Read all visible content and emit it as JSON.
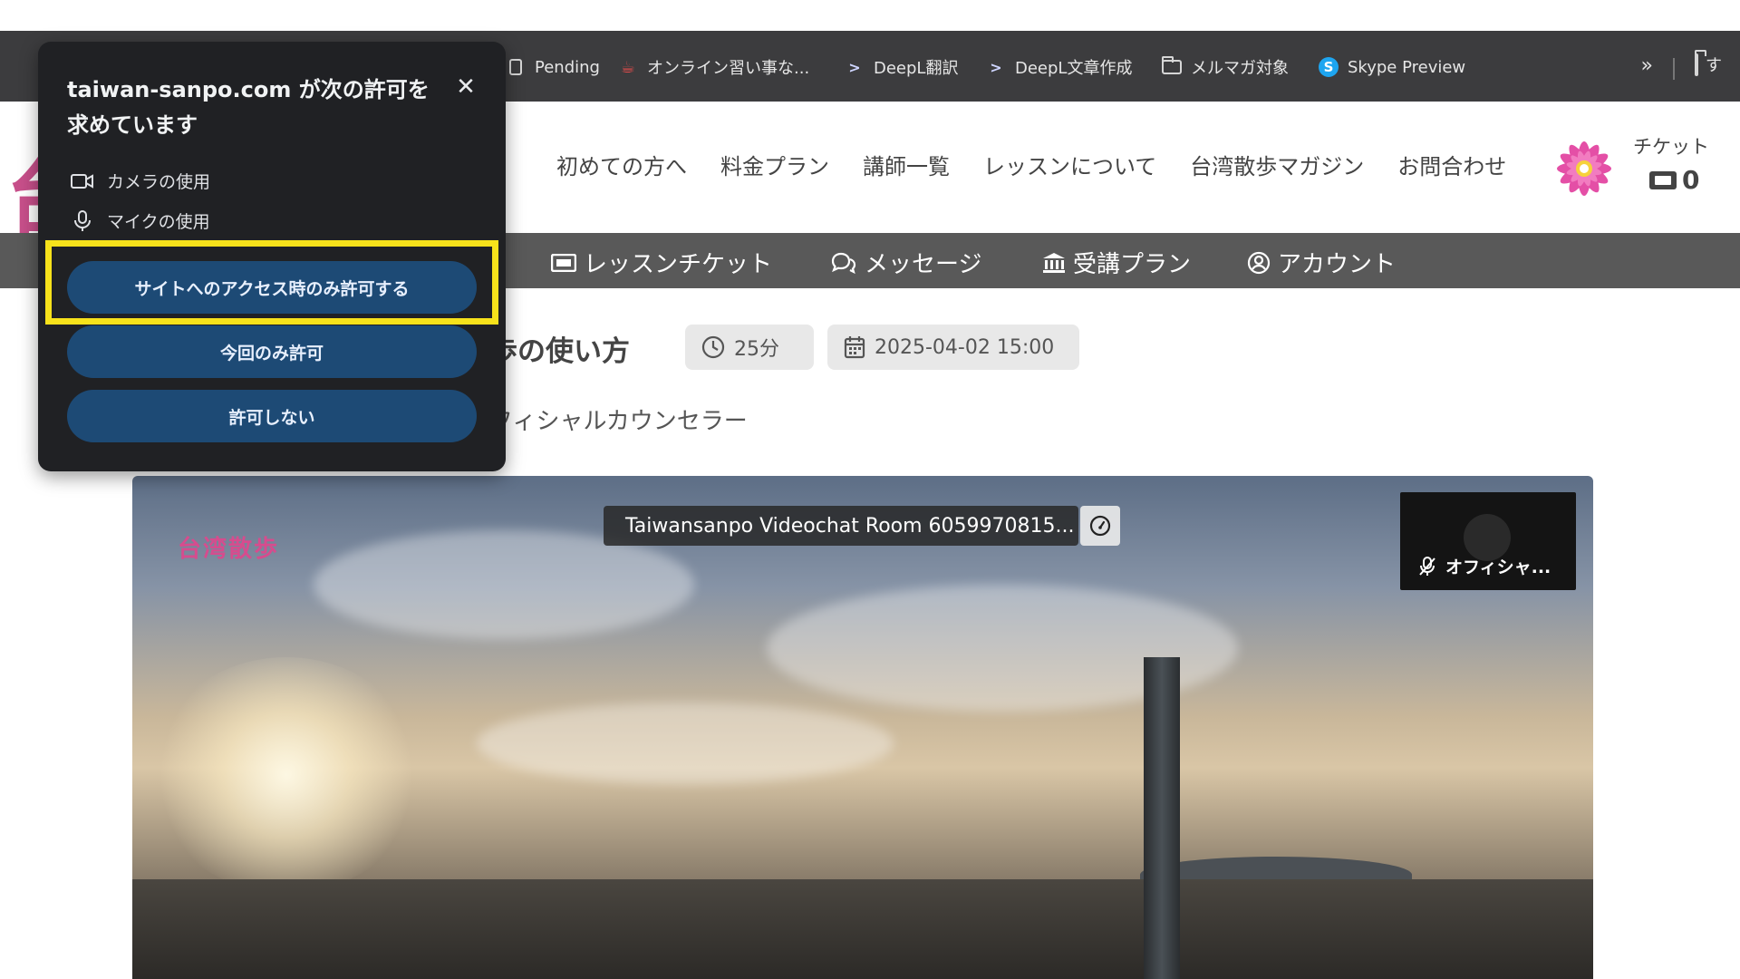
{
  "bookmarks": {
    "items": [
      {
        "label": "Pending",
        "icon": "page-icon"
      },
      {
        "label": "オンライン習い事な...",
        "icon": "cup-icon"
      },
      {
        "label": "DeepL翻訳",
        "icon": "deepl-icon"
      },
      {
        "label": "DeepL文章作成",
        "icon": "deepl-icon"
      },
      {
        "label": "メルマガ対象",
        "icon": "folder-icon"
      },
      {
        "label": "Skype Preview",
        "icon": "skype-icon"
      }
    ],
    "more": "»",
    "last_folder_label": "す"
  },
  "site": {
    "logo_char": "台",
    "nav": [
      "初めての方へ",
      "料金プラン",
      "講師一覧",
      "レッスンについて",
      "台湾散歩マガジン",
      "お問合わせ"
    ],
    "ticket_label": "チケット",
    "ticket_count": "0"
  },
  "subnav": {
    "items": [
      "レッスンチケット",
      "メッセージ",
      "受講プラン",
      "アカウント"
    ]
  },
  "lesson": {
    "title": "歩の使い方",
    "duration": "25分",
    "datetime": "2025-04-02 15:00",
    "teacher": "フィシャルカウンセラー"
  },
  "video": {
    "logo": "台湾散歩",
    "room_name": "Taiwansanpo Videochat Room 6059970815...",
    "participant_label": "オフィシャ..."
  },
  "permission": {
    "title": "taiwan-sanpo.com が次の許可を求めています",
    "camera": "カメラの使用",
    "mic": "マイクの使用",
    "allow_while_visiting": "サイトへのアクセス時のみ許可する",
    "allow_this_time": "今回のみ許可",
    "deny": "許可しない",
    "highlight_color": "#f7e21b"
  }
}
